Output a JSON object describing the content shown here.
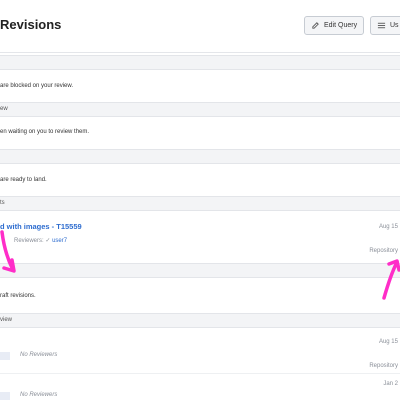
{
  "header": {
    "title": "Revisions",
    "edit_query_label": "Edit Query",
    "use_label": "Us"
  },
  "sections": [
    {
      "head": "",
      "message": "are blocked on your review."
    },
    {
      "head": "ew",
      "message": "en waiting on you to review them."
    },
    {
      "head": "",
      "message": "are ready to land."
    },
    {
      "head": "ts",
      "message": ""
    },
    {
      "head": "",
      "message": "raft revisions."
    },
    {
      "head": "view",
      "message": ""
    }
  ],
  "revision": {
    "title": "d with images - T15559",
    "reviewers_label": "Reviewers:",
    "reviewer_user": "user7",
    "date": "Aug 15",
    "repo": "Repository"
  },
  "review_rows": [
    {
      "reviewers": "No Reviewers",
      "date": "Aug 15",
      "repo": "Repository"
    },
    {
      "reviewers": "No Reviewers",
      "date": "Jan 2"
    }
  ],
  "annotations": {
    "arrow_color": "#ff2dc8"
  }
}
